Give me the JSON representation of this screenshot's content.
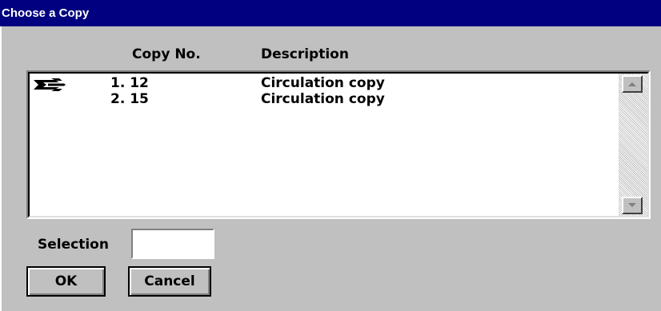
{
  "window": {
    "title": "Choose a Copy"
  },
  "list": {
    "columns": {
      "copy_no": "Copy No.",
      "description": "Description"
    },
    "rows": [
      {
        "number": "1.",
        "copy_no": "12",
        "description": "Circulation copy",
        "label": "1. 12"
      },
      {
        "number": "2.",
        "copy_no": "15",
        "description": "Circulation copy",
        "label": "2. 15"
      }
    ],
    "selected_row": 1
  },
  "selection": {
    "label": "Selection",
    "value": ""
  },
  "buttons": {
    "ok": "OK",
    "cancel": "Cancel"
  },
  "icons": {
    "pointer": "right-arrow-pointer-icon",
    "scroll_up": "scroll-up-arrow-icon",
    "scroll_down": "scroll-down-arrow-icon"
  },
  "colors": {
    "titlebar": "#000080",
    "window_bg": "#c0c0c0",
    "list_bg": "#ffffff"
  }
}
